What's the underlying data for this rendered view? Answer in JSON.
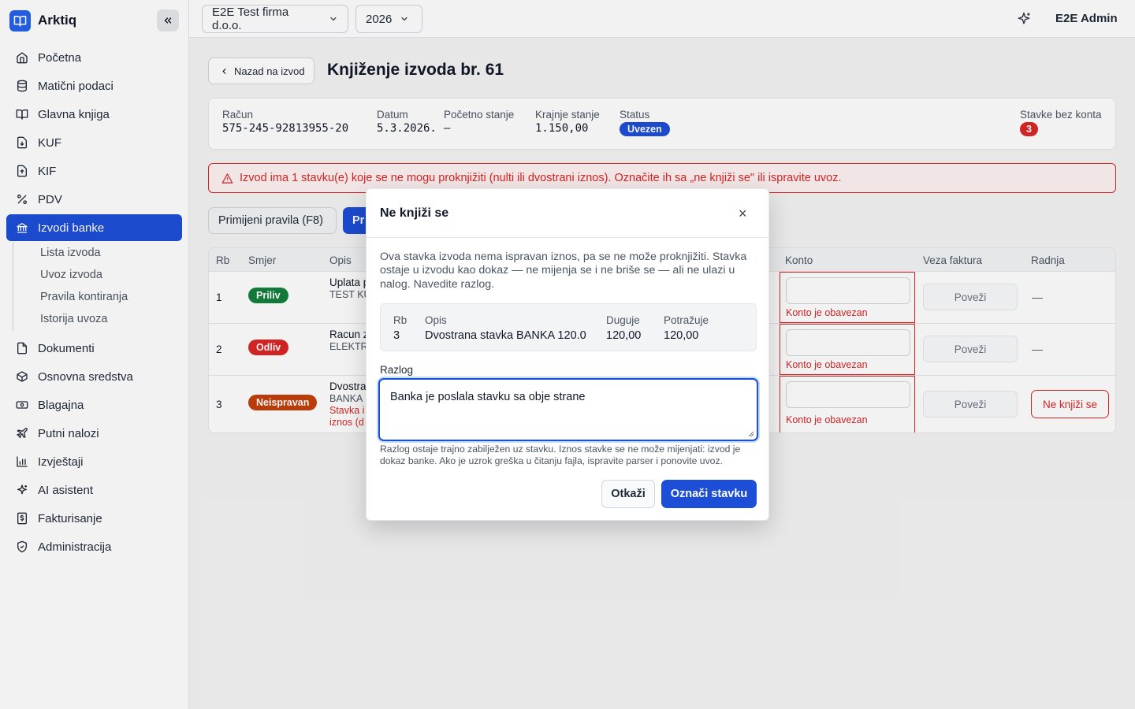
{
  "app": {
    "name": "Arktiq"
  },
  "sidebar": {
    "items": [
      {
        "label": "Početna",
        "icon": "home-icon"
      },
      {
        "label": "Matični podaci",
        "icon": "database-icon"
      },
      {
        "label": "Glavna knjiga",
        "icon": "book-icon"
      },
      {
        "label": "KUF",
        "icon": "file-in-icon"
      },
      {
        "label": "KIF",
        "icon": "file-out-icon"
      },
      {
        "label": "PDV",
        "icon": "percent-icon"
      },
      {
        "label": "Izvodi banke",
        "icon": "bank-icon"
      },
      {
        "label": "Dokumenti",
        "icon": "folder-icon"
      },
      {
        "label": "Osnovna sredstva",
        "icon": "box-icon"
      },
      {
        "label": "Blagajna",
        "icon": "cash-icon"
      },
      {
        "label": "Putni nalozi",
        "icon": "plane-icon"
      },
      {
        "label": "Izvještaji",
        "icon": "chart-icon"
      },
      {
        "label": "AI asistent",
        "icon": "sparkles-icon"
      },
      {
        "label": "Fakturisanje",
        "icon": "invoice-icon"
      },
      {
        "label": "Administracija",
        "icon": "shield-icon"
      }
    ],
    "subitems": [
      "Lista izvoda",
      "Uvoz izvoda",
      "Pravila kontiranja",
      "Istorija uvoza"
    ]
  },
  "topbar": {
    "company": "E2E Test firma d.o.o.",
    "year": "2026",
    "user": "E2E Admin"
  },
  "page": {
    "back_label": "Nazad na izvod",
    "title": "Knjiženje izvoda br. 61",
    "info": {
      "racun_label": "Račun",
      "racun": "575-245-92813955-20",
      "datum_label": "Datum",
      "datum": "5.3.2026.",
      "pocetno_label": "Početno stanje",
      "pocetno": "—",
      "krajnje_label": "Krajnje stanje",
      "krajnje": "1.150,00",
      "status_label": "Status",
      "status": "Uvezen",
      "bez_konta_label": "Stavke bez konta",
      "bez_konta": "3"
    },
    "alert": "Izvod ima 1 stavku(e) koje se ne mogu proknjižiti (nulti ili dvostrani iznos). Označite ih sa „ne knjiži se\" ili ispravite uvoz.",
    "btn_rules": "Primijeni pravila (F8)",
    "btn_primary_partial": "Pr",
    "table": {
      "headers": [
        "Rb",
        "Smjer",
        "Opis",
        "Konto",
        "Veza faktura",
        "Radnja"
      ],
      "rows": [
        {
          "rb": "1",
          "smjer": "Priliv",
          "opis1": "Uplata p",
          "opis2": "TEST KU",
          "konto_err": "Konto je obavezan",
          "povezi": "Poveži",
          "radnja": "—"
        },
        {
          "rb": "2",
          "smjer": "Odliv",
          "opis1": "Racun z",
          "opis2": "ELEKTRO",
          "konto_err": "Konto je obavezan",
          "povezi": "Poveži",
          "radnja": "—"
        },
        {
          "rb": "3",
          "smjer": "Neispravan",
          "opis1": "Dvostra",
          "opis2": "BANKA ",
          "opis3": "Stavka i",
          "opis4": "iznos (d",
          "konto_err": "Konto je obavezan",
          "povezi": "Poveži",
          "radnja": "Ne knjiži se"
        }
      ]
    }
  },
  "modal": {
    "title": "Ne knjiži se",
    "close": "×",
    "description": "Ova stavka izvoda nema ispravan iznos, pa se ne može proknjižiti. Stavka ostaje u izvodu kao dokaz — ne mijenja se i ne briše se — ali ne ulazi u nalog. Navedite razlog.",
    "detail": {
      "rb_label": "Rb",
      "rb": "3",
      "opis_label": "Opis",
      "opis": "Dvostrana stavka BANKA 120.0",
      "duguje_label": "Duguje",
      "duguje": "120,00",
      "potrazuje_label": "Potražuje",
      "potrazuje": "120,00"
    },
    "reason_label": "Razlog",
    "reason_value": "Banka je poslala stavku sa obje strane",
    "help": "Razlog ostaje trajno zabilježen uz stavku. Iznos stavke se ne može mijenjati: izvod je dokaz banke. Ako je uzrok greška u čitanju fajla, ispravite parser i ponovite uvoz.",
    "cancel": "Otkaži",
    "confirm": "Označi stavku"
  },
  "colors": {
    "primary": "#1d4ed8",
    "danger": "#dc2626",
    "success": "#15803d",
    "warning": "#c2410c"
  }
}
